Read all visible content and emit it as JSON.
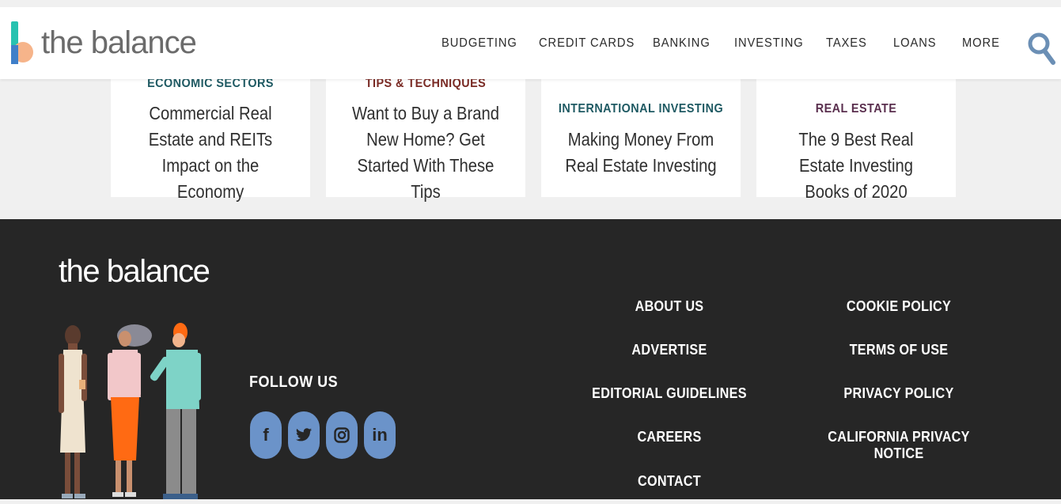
{
  "header": {
    "logo_text": "the balance",
    "nav": [
      {
        "label": "BUDGETING"
      },
      {
        "label": "CREDIT CARDS"
      },
      {
        "label": "BANKING"
      },
      {
        "label": "INVESTING"
      },
      {
        "label": "TAXES"
      },
      {
        "label": "LOANS"
      },
      {
        "label": "MORE"
      }
    ],
    "search_icon": "search-icon"
  },
  "cards": [
    {
      "category": "ECONOMIC SECTORS",
      "title": "Commercial Real Estate and REITs Impact on the Economy",
      "category_color": "#1f5a63",
      "shadow_color": "#dcecec"
    },
    {
      "category": "TIPS & TECHNIQUES",
      "title": "Want to Buy a Brand New Home? Get Started With These Tips",
      "category_color": "#7a2a24",
      "shadow_color": "#f4dcd8"
    },
    {
      "category": "INTERNATIONAL INVESTING",
      "title": "Making Money From Real Estate Investing",
      "category_color": "#1f5a63",
      "shadow_color": "#d9edf5"
    },
    {
      "category": "REAL ESTATE",
      "title": "The 9 Best Real Estate Investing Books of 2020",
      "category_color": "#5a2f4e",
      "shadow_color": "#efe3ef"
    }
  ],
  "footer": {
    "logo_text": "the balance",
    "follow_label": "FOLLOW US",
    "social": [
      {
        "icon": "facebook-icon",
        "glyph": "f"
      },
      {
        "icon": "twitter-icon",
        "glyph": "🐦"
      },
      {
        "icon": "instagram-icon",
        "glyph": "◎"
      },
      {
        "icon": "linkedin-icon",
        "glyph": "in"
      }
    ],
    "links_col1": [
      "ABOUT US",
      "ADVERTISE",
      "EDITORIAL GUIDELINES",
      "CAREERS",
      "CONTACT"
    ],
    "links_col2": [
      "COOKIE POLICY",
      "TERMS OF USE",
      "PRIVACY POLICY",
      "CALIFORNIA PRIVACY NOTICE"
    ]
  },
  "colors": {
    "brand_teal": "#27c2b0",
    "social_blue": "#6b93c9",
    "footer_bg": "#262626"
  }
}
